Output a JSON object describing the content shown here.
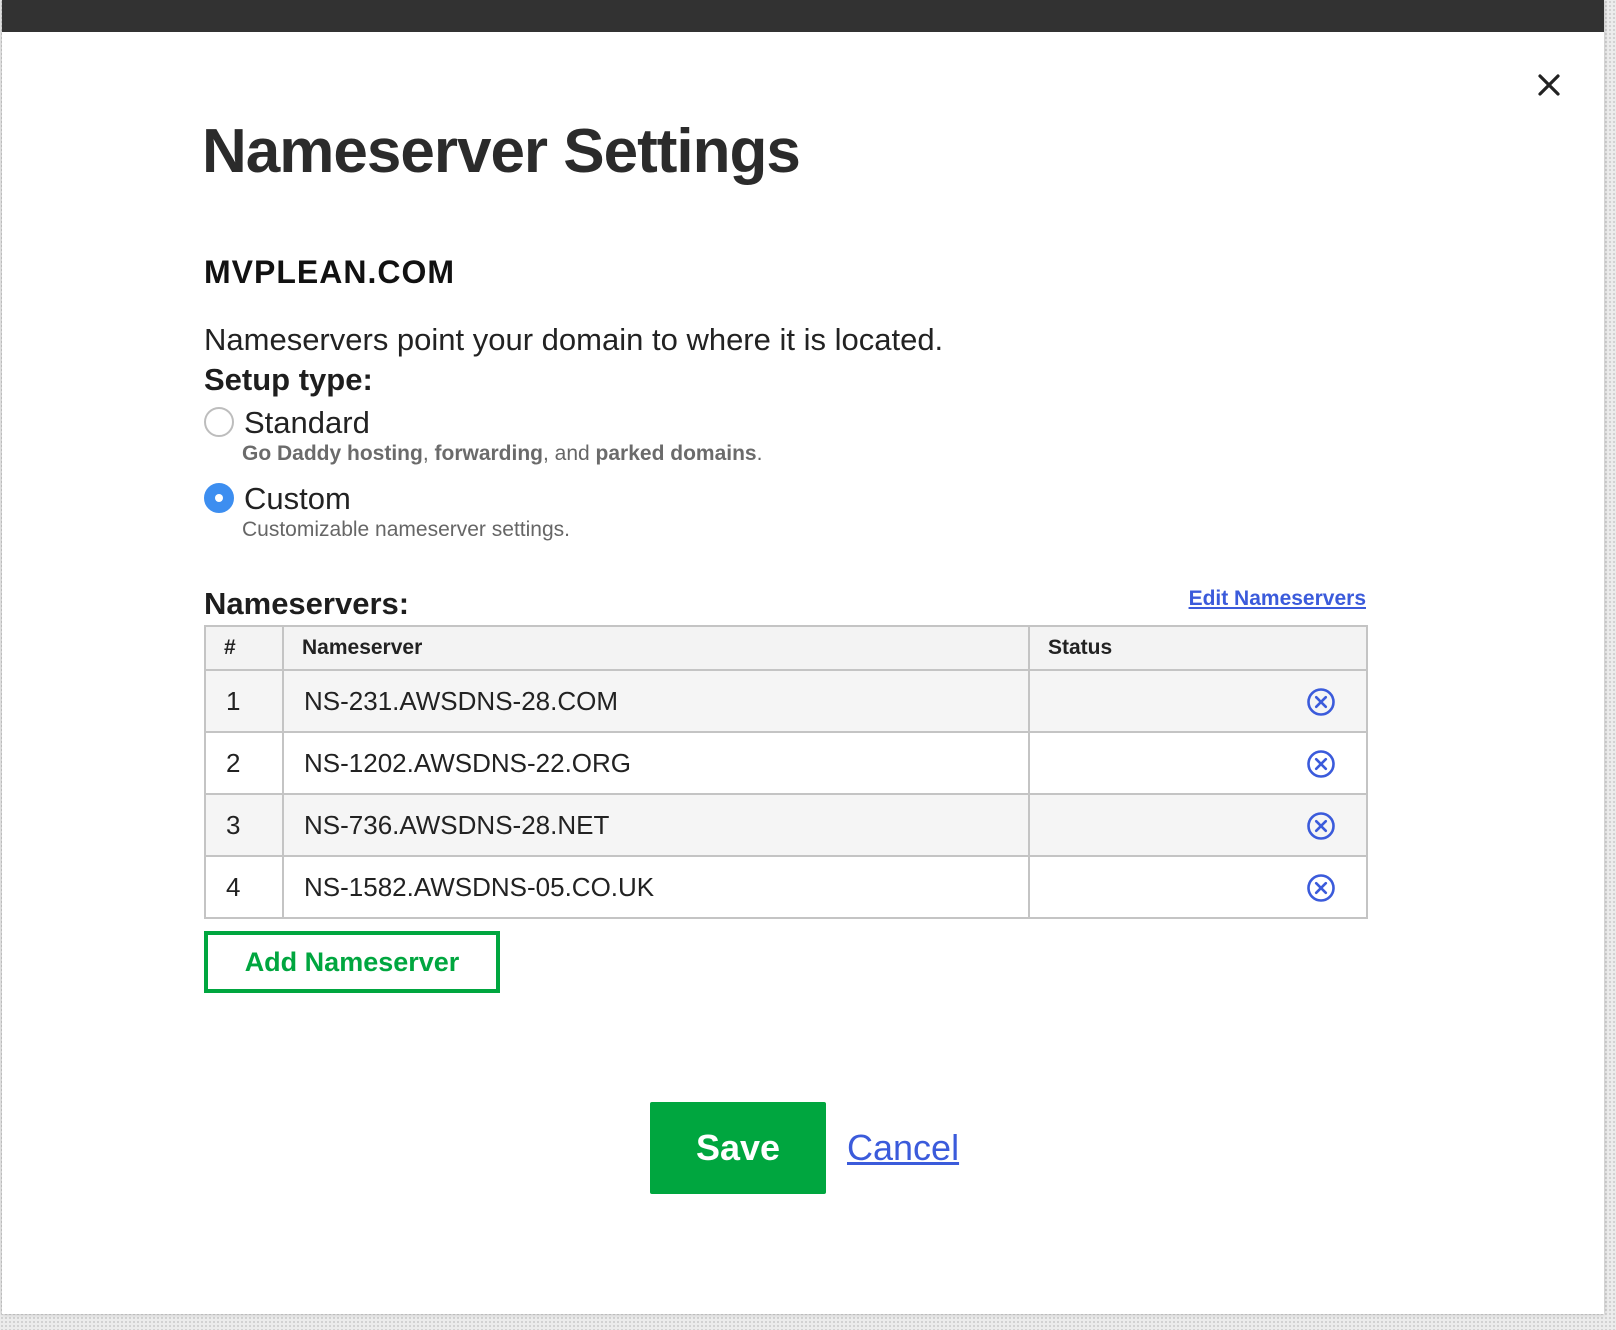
{
  "dialog": {
    "title": "Nameserver Settings",
    "domain": "MVPLEAN.COM",
    "intro": "Nameservers point your domain to where it is located.",
    "setup_label": "Setup type:"
  },
  "setup_options": {
    "standard": {
      "label": "Standard",
      "checked": false,
      "desc_part1": "Go Daddy hosting",
      "desc_sep1": ", ",
      "desc_part2": "forwarding",
      "desc_sep2": ", and ",
      "desc_part3": "parked domains",
      "desc_end": "."
    },
    "custom": {
      "label": "Custom",
      "checked": true,
      "desc": "Customizable nameserver settings."
    }
  },
  "nameservers": {
    "label": "Nameservers:",
    "edit_link": "Edit Nameservers",
    "columns": {
      "num": "#",
      "nameserver": "Nameserver",
      "status": "Status"
    },
    "rows": [
      {
        "num": "1",
        "nameserver": "NS-231.AWSDNS-28.COM",
        "status": ""
      },
      {
        "num": "2",
        "nameserver": "NS-1202.AWSDNS-22.ORG",
        "status": ""
      },
      {
        "num": "3",
        "nameserver": "NS-736.AWSDNS-28.NET",
        "status": ""
      },
      {
        "num": "4",
        "nameserver": "NS-1582.AWSDNS-05.CO.UK",
        "status": ""
      }
    ],
    "add_button": "Add Nameserver"
  },
  "actions": {
    "save": "Save",
    "cancel": "Cancel"
  },
  "icons": {
    "close": "close-icon",
    "remove": "remove-circle-icon"
  },
  "colors": {
    "primary_green": "#00a63f",
    "link_blue": "#3b5bdb",
    "radio_blue": "#3d8ef0",
    "topbar": "#323232"
  }
}
